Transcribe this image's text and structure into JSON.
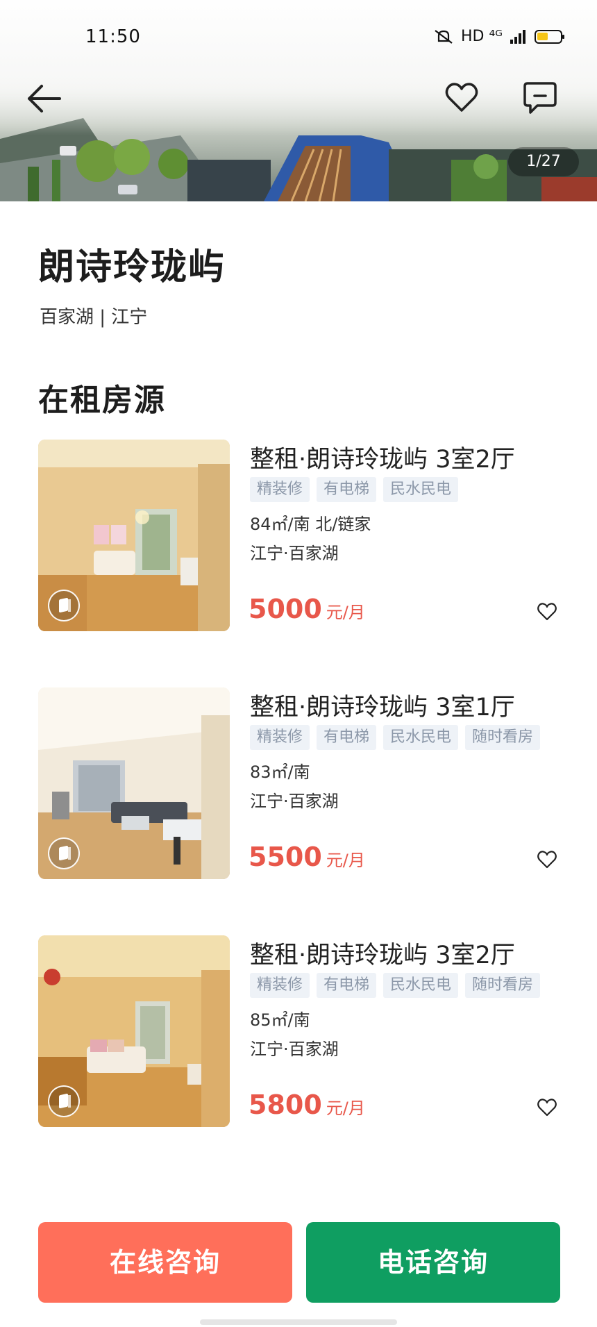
{
  "status_bar": {
    "time": "11:50",
    "network": "HD ⁴ᴳ",
    "battery_icon": "battery-low-icon"
  },
  "header": {
    "back_icon": "arrow-left-icon",
    "favorite_icon": "heart-outline-icon",
    "message_icon": "chat-bubble-icon",
    "photo_counter": "1/27"
  },
  "community": {
    "name": "朗诗玲珑屿",
    "location": "百家湖 | 江宁"
  },
  "section": {
    "title": "在租房源"
  },
  "listings": [
    {
      "title": "整租·朗诗玲珑屿 3室2厅",
      "tags": [
        "精装修",
        "有电梯",
        "民水民电"
      ],
      "meta": "84㎡/南 北/链家",
      "area": "江宁·百家湖",
      "price": "5000",
      "unit": "元/月"
    },
    {
      "title": "整租·朗诗玲珑屿 3室1厅",
      "tags": [
        "精装修",
        "有电梯",
        "民水民电",
        "随时看房"
      ],
      "meta": "83㎡/南",
      "area": "江宁·百家湖",
      "price": "5500",
      "unit": "元/月"
    },
    {
      "title": "整租·朗诗玲珑屿 3室2厅",
      "tags": [
        "精装修",
        "有电梯",
        "民水民电",
        "随时看房"
      ],
      "meta": "85㎡/南",
      "area": "江宁·百家湖",
      "price": "5800",
      "unit": "元/月"
    }
  ],
  "actions": {
    "online": "在线咨询",
    "phone": "电话咨询"
  },
  "colors": {
    "price": "#e8574a",
    "online_button": "#ff6f5a",
    "phone_button": "#0f9e61",
    "tag_bg": "#eef2f7",
    "tag_text": "#8b97a8"
  }
}
